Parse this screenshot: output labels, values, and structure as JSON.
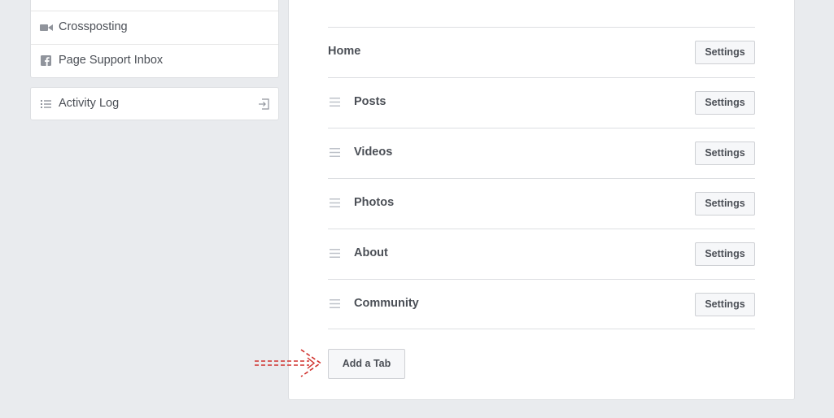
{
  "sidebar": {
    "items": [
      {
        "label": "Crossposting",
        "icon": "video-camera-icon"
      },
      {
        "label": "Page Support Inbox",
        "icon": "facebook-icon"
      }
    ],
    "activity_log": {
      "label": "Activity Log",
      "icon": "list-icon",
      "action_icon": "exit-arrow-icon"
    }
  },
  "tabs": {
    "rows": [
      {
        "label": "Home",
        "button": "Settings",
        "draggable": false
      },
      {
        "label": "Posts",
        "button": "Settings",
        "draggable": true
      },
      {
        "label": "Videos",
        "button": "Settings",
        "draggable": true
      },
      {
        "label": "Photos",
        "button": "Settings",
        "draggable": true
      },
      {
        "label": "About",
        "button": "Settings",
        "draggable": true
      },
      {
        "label": "Community",
        "button": "Settings",
        "draggable": true
      }
    ],
    "add_button": "Add a Tab"
  },
  "colors": {
    "page_background": "#e9ebee",
    "text": "#4b4f56",
    "icon_gray": "#90949c",
    "annotation_red": "#d0312d"
  }
}
